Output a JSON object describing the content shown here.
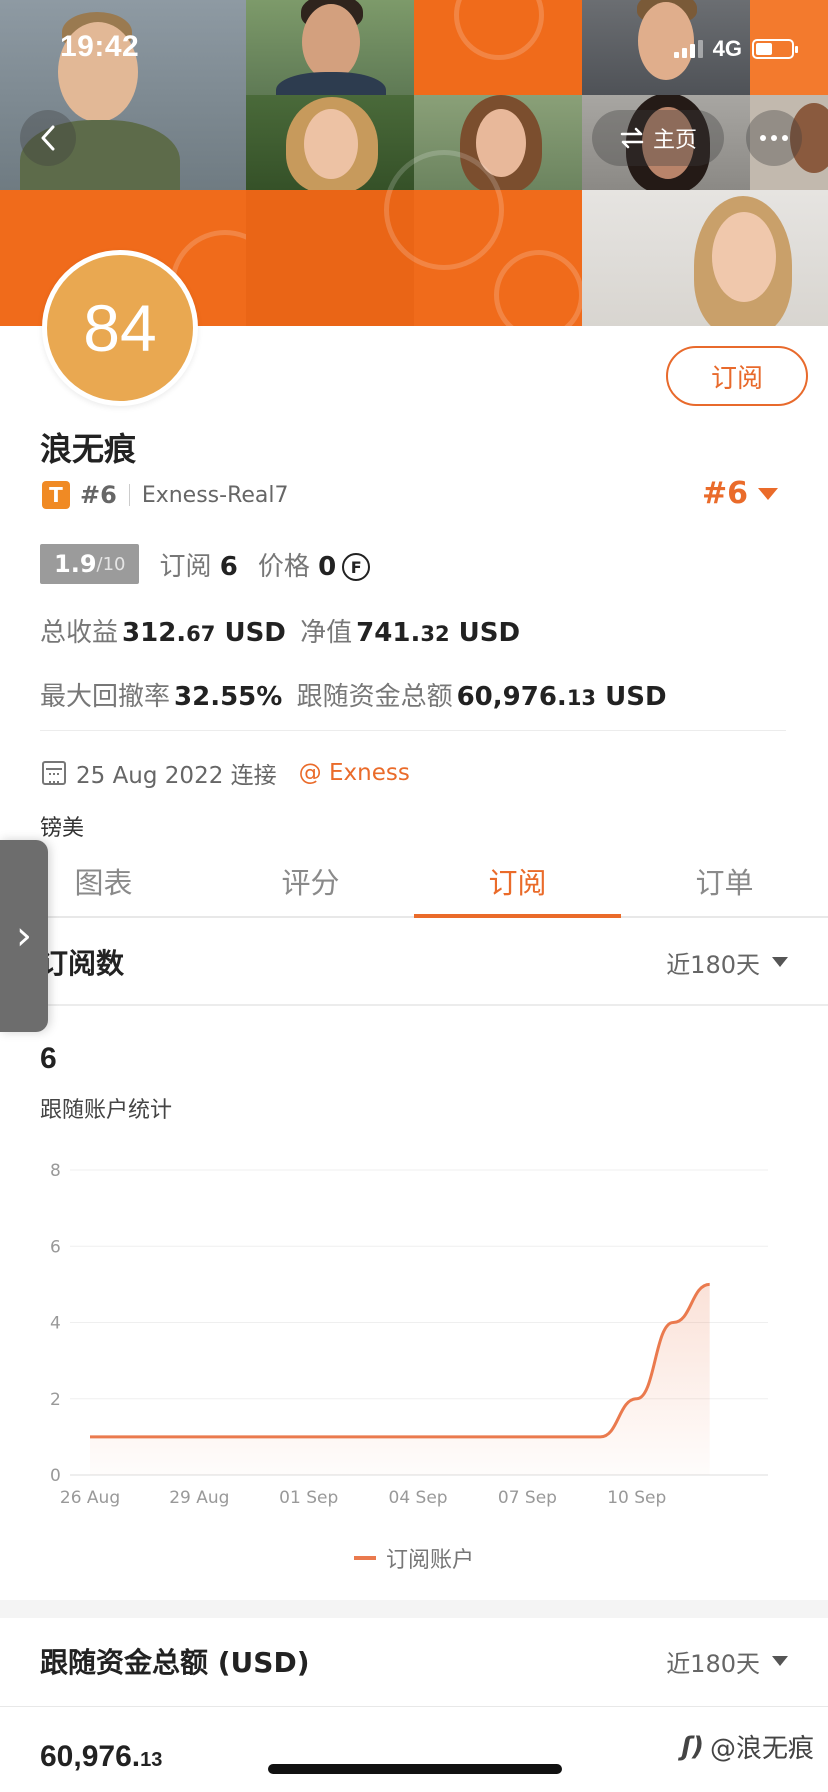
{
  "status_bar": {
    "time": "19:42",
    "network": "4G"
  },
  "nav": {
    "home_label": "主页",
    "back_icon": "chevron-left-icon",
    "more_icon": "more-dots-icon",
    "swap_icon": "swap-arrows-icon"
  },
  "profile": {
    "score": "84",
    "subscribe_label": "订阅",
    "name": "浪无痕",
    "badge": "T",
    "rank": "#6",
    "account": "Exness-Real7",
    "rank_right": "#6",
    "rating_value": "1.9",
    "rating_max": "/10",
    "subscribers_label": "订阅",
    "subscribers_value": "6",
    "price_label": "价格",
    "price_value": "0",
    "price_coin": "F",
    "total_profit_label": "总收益",
    "total_profit_int": "312.",
    "total_profit_dec": "67",
    "total_profit_unit": "USD",
    "equity_label": "净值",
    "equity_int": "741.",
    "equity_dec": "32",
    "equity_unit": "USD",
    "max_dd_label": "最大回撤率",
    "max_dd_value": "32.55%",
    "follow_funds_label": "跟随资金总额",
    "follow_funds_int": "60,976.",
    "follow_funds_dec": "13",
    "follow_funds_unit": "USD",
    "connected_date": "25 Aug 2022 连接",
    "broker": "@ Exness",
    "note": "镑美"
  },
  "side_tab": {
    "icon": "chevron-right-icon",
    "glyph": "›"
  },
  "tabs": [
    "图表",
    "评分",
    "订阅",
    "订单"
  ],
  "active_tab": 2,
  "subscriptions_section": {
    "title": "订阅数",
    "range": "近180天",
    "value": "6",
    "subtitle": "跟随账户统计",
    "legend": "订阅账户"
  },
  "chart_data": {
    "type": "area",
    "x": [
      "26 Aug",
      "27 Aug",
      "28 Aug",
      "29 Aug",
      "30 Aug",
      "31 Aug",
      "01 Sep",
      "02 Sep",
      "03 Sep",
      "04 Sep",
      "05 Sep",
      "06 Sep",
      "07 Sep",
      "08 Sep",
      "09 Sep",
      "10 Sep",
      "11 Sep",
      "12 Sep"
    ],
    "x_ticks": [
      "26 Aug",
      "29 Aug",
      "01 Sep",
      "04 Sep",
      "07 Sep",
      "10 Sep"
    ],
    "series": [
      {
        "name": "订阅账户",
        "values": [
          1,
          1,
          1,
          1,
          1,
          1,
          1,
          1,
          1,
          1,
          1,
          1,
          1,
          1,
          1,
          2,
          4,
          5
        ]
      }
    ],
    "ylim": [
      0,
      8
    ],
    "y_ticks": [
      0,
      2,
      4,
      6,
      8
    ],
    "grid": true,
    "legend_position": "bottom",
    "color": "#ea7a4e"
  },
  "funds_section": {
    "title": "跟随资金总额 (USD)",
    "range": "近180天",
    "value_int": "60,976.",
    "value_dec": "13"
  },
  "watermark": "@浪无痕",
  "colors": {
    "accent": "#ea6b2a",
    "score_bg": "#e9a851",
    "banner": "#f06b1b"
  }
}
